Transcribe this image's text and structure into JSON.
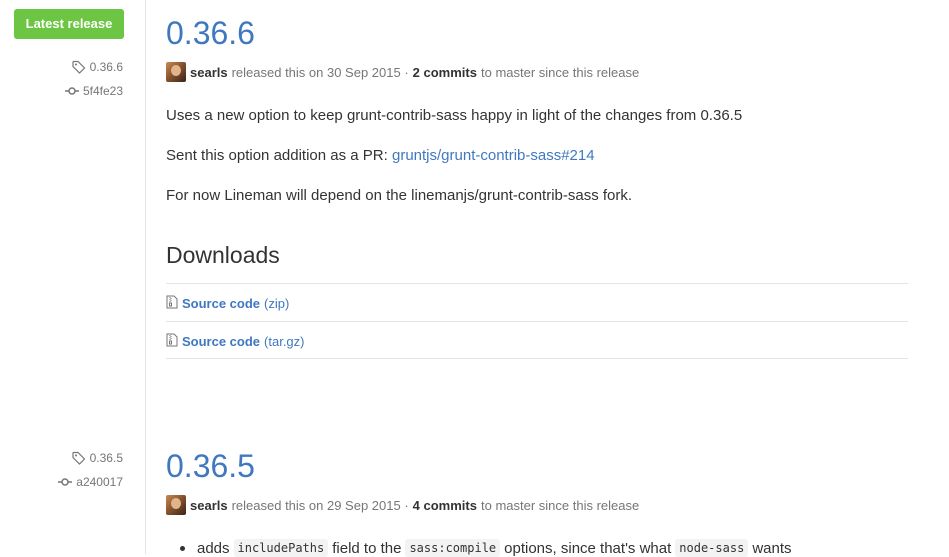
{
  "releases": [
    {
      "badge": "Latest release",
      "tag": "0.36.6",
      "commit": "5f4fe23",
      "title": "0.36.6",
      "author": "searls",
      "released_text": "released this on 30 Sep 2015 ·",
      "commits_label": "2 commits",
      "since_text": "to master since this release",
      "body": [
        {
          "text": "Uses a new option to keep grunt-contrib-sass happy in light of the changes from 0.36.5"
        },
        {
          "text": "Sent this option addition as a PR: ",
          "link": "gruntjs/grunt-contrib-sass#214"
        },
        {
          "text": "For now Lineman will depend on the linemanjs/grunt-contrib-sass fork."
        }
      ],
      "downloads_title": "Downloads",
      "downloads": [
        {
          "name": "Source code",
          "ext": "(zip)"
        },
        {
          "name": "Source code",
          "ext": "(tar.gz)"
        }
      ]
    },
    {
      "tag": "0.36.5",
      "commit": "a240017",
      "title": "0.36.5",
      "author": "searls",
      "released_text": "released this on 29 Sep 2015 ·",
      "commits_label": "4 commits",
      "since_text": "to master since this release",
      "bullet": {
        "prefix": "adds",
        "code1": "includePaths",
        "mid1": "field to the",
        "code2": "sass:compile",
        "mid2": "options, since that's what",
        "code3": "node-sass",
        "suffix": "wants"
      }
    }
  ],
  "colors": {
    "accent": "#4078c0",
    "badge_green": "#6cc644",
    "muted": "#767676"
  }
}
